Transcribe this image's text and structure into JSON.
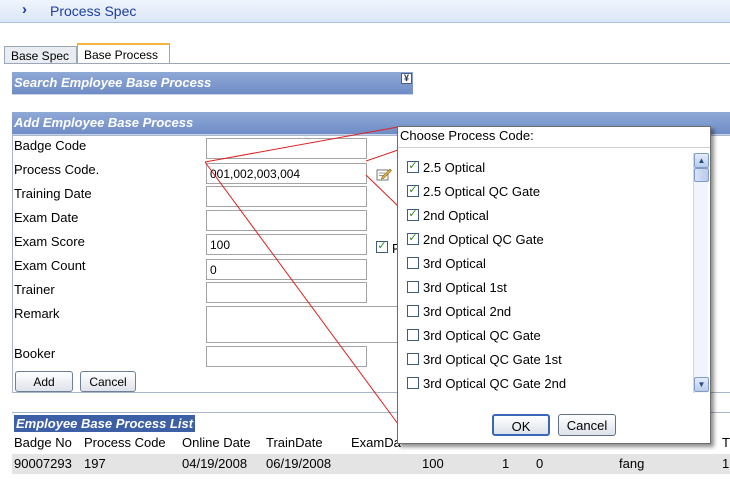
{
  "window": {
    "title": "Process Spec"
  },
  "tabs": [
    {
      "label": "Base Spec",
      "active": false
    },
    {
      "label": "Base Process",
      "active": true
    }
  ],
  "search_panel": {
    "title": "Search Employee Base Process"
  },
  "add_panel": {
    "title": "Add Employee Base Process",
    "fields": [
      {
        "label": "Badge Code",
        "value": ""
      },
      {
        "label": "Process Code.",
        "value": "001,002,003,004"
      },
      {
        "label": "Training Date",
        "value": ""
      },
      {
        "label": "Exam Date",
        "value": ""
      },
      {
        "label": "Exam Score",
        "value": "100"
      },
      {
        "label": "Exam Count",
        "value": "0"
      },
      {
        "label": "Trainer",
        "value": ""
      },
      {
        "label": "Remark",
        "value": ""
      },
      {
        "label": "Booker",
        "value": ""
      }
    ],
    "pass_label": "P",
    "pass_checked": true,
    "add_label": "Add",
    "cancel_label": "Cancel"
  },
  "list": {
    "title": "Employee Base Process List",
    "columns": [
      "Badge No",
      "Process Code",
      "Online Date",
      "TrainDate",
      "ExamDa",
      "T"
    ],
    "rows": [
      [
        "90007293",
        "197",
        "04/19/2008",
        "06/19/2008",
        "",
        "100",
        "1",
        "0",
        "fang",
        "1"
      ]
    ]
  },
  "dialog": {
    "title": "Choose Process Code:",
    "items": [
      {
        "label": "2.5 Optical",
        "checked": true
      },
      {
        "label": "2.5 Optical QC Gate",
        "checked": true
      },
      {
        "label": "2nd Optical",
        "checked": true
      },
      {
        "label": "2nd Optical QC Gate",
        "checked": true
      },
      {
        "label": "3rd Optical",
        "checked": false
      },
      {
        "label": "3rd Optical 1st",
        "checked": false
      },
      {
        "label": "3rd Optical 2nd",
        "checked": false
      },
      {
        "label": "3rd Optical QC Gate",
        "checked": false
      },
      {
        "label": "3rd Optical QC Gate 1st",
        "checked": false
      },
      {
        "label": "3rd Optical QC Gate 2nd",
        "checked": false
      }
    ],
    "ok_label": "OK",
    "cancel_label": "Cancel"
  },
  "colors": {
    "header_blue": "#6f8cc6",
    "title_blue": "#1d3f9b",
    "list_header": "#3d5fa6",
    "callout_red": "#e02020"
  }
}
